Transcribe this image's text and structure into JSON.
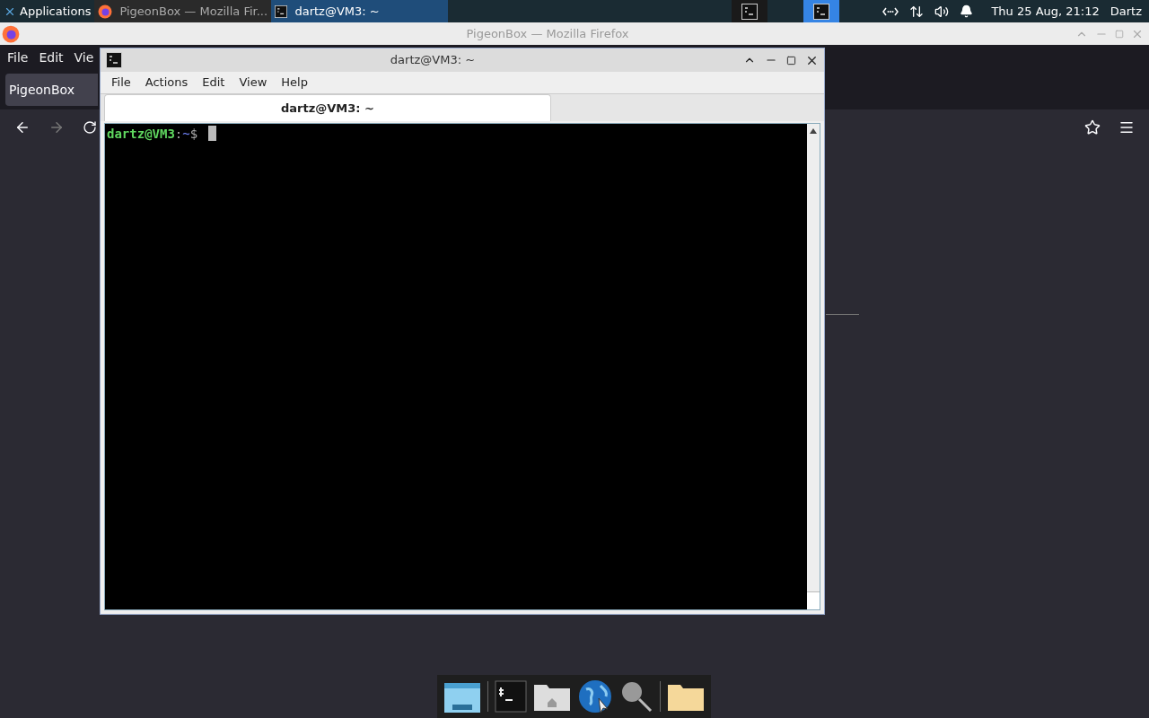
{
  "taskbar": {
    "menu": "Applications",
    "windows": [
      {
        "label": "PigeonBox — Mozilla Fir...",
        "kind": "browser",
        "selected": false
      },
      {
        "label": "dartz@VM3: ~",
        "kind": "terminal",
        "selected": true
      }
    ],
    "workspaces": [
      {
        "selected": false
      },
      {
        "selected": true
      }
    ],
    "clock": "Thu 25 Aug, 21:12",
    "user": "Dartz"
  },
  "browser": {
    "title": "PigeonBox — Mozilla Firefox",
    "menu": [
      "File",
      "Edit",
      "Vie"
    ],
    "tab": "PigeonBox"
  },
  "terminal": {
    "title": "dartz@VM3: ~",
    "menu": [
      "File",
      "Actions",
      "Edit",
      "View",
      "Help"
    ],
    "tabs": [
      {
        "label": "dartz@VM3: ~",
        "selected": true
      }
    ],
    "prompt": {
      "user_host": "dartz@VM3",
      "separator": ":",
      "path": "~",
      "symbol": "$"
    },
    "cursor": true
  }
}
